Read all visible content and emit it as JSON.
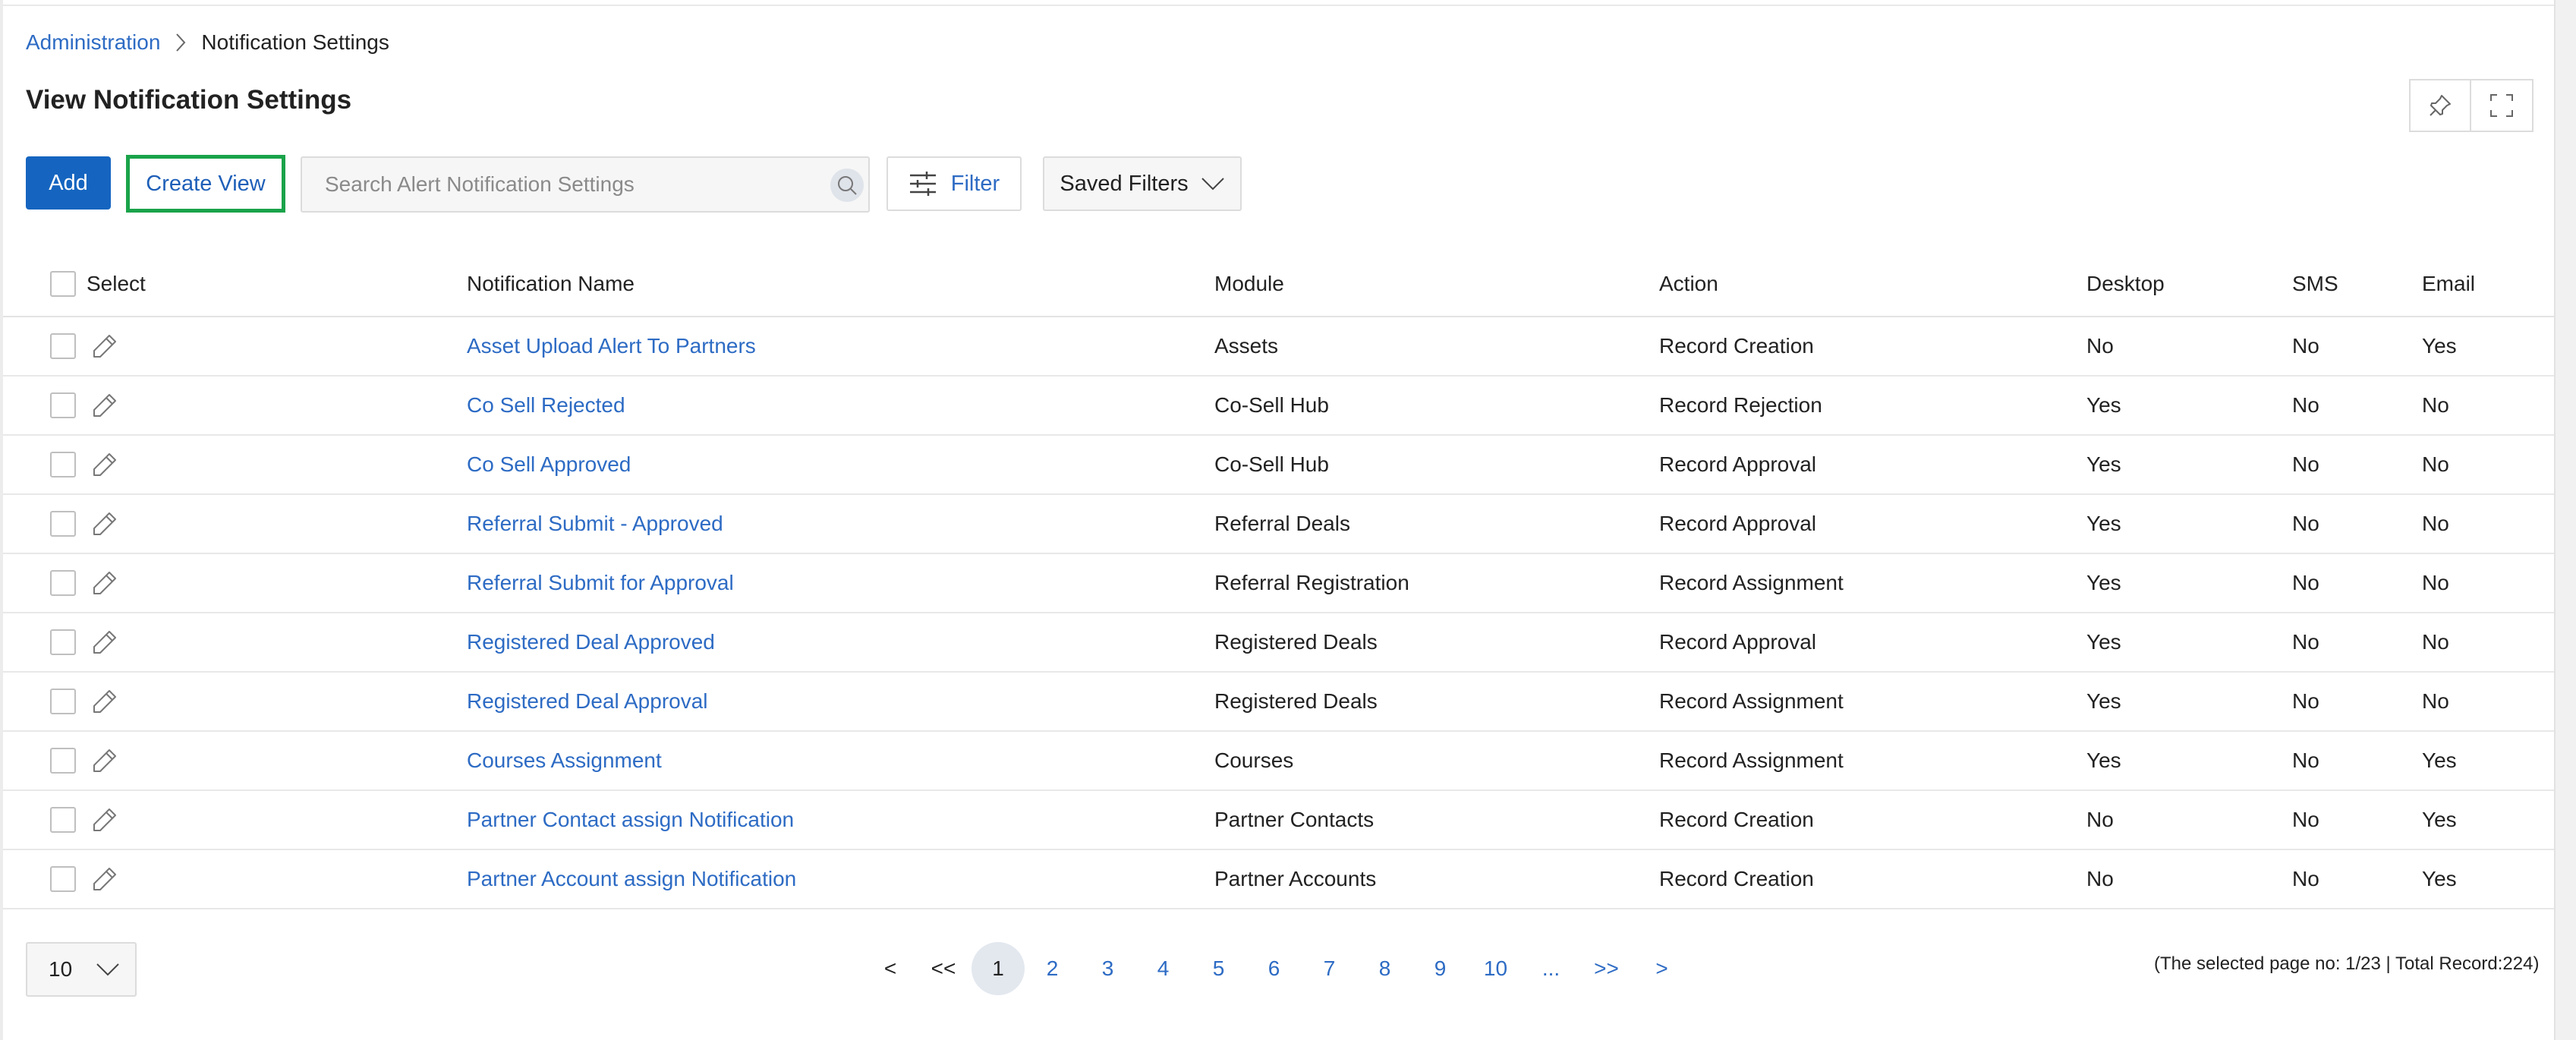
{
  "breadcrumb": {
    "root": "Administration",
    "current": "Notification Settings"
  },
  "page_title": "View Notification Settings",
  "toolbar": {
    "add_label": "Add",
    "create_view_label": "Create View",
    "search_placeholder": "Search Alert Notification Settings",
    "filter_label": "Filter",
    "saved_filters_label": "Saved Filters"
  },
  "table": {
    "columns": {
      "select": "Select",
      "name": "Notification Name",
      "module": "Module",
      "action": "Action",
      "desktop": "Desktop",
      "sms": "SMS",
      "email": "Email"
    },
    "rows": [
      {
        "name": "Asset Upload Alert To Partners",
        "module": "Assets",
        "action": "Record Creation",
        "desktop": "No",
        "sms": "No",
        "email": "Yes"
      },
      {
        "name": "Co Sell Rejected",
        "module": "Co-Sell Hub",
        "action": "Record Rejection",
        "desktop": "Yes",
        "sms": "No",
        "email": "No"
      },
      {
        "name": "Co Sell Approved",
        "module": "Co-Sell Hub",
        "action": "Record Approval",
        "desktop": "Yes",
        "sms": "No",
        "email": "No"
      },
      {
        "name": "Referral Submit - Approved",
        "module": "Referral Deals",
        "action": "Record Approval",
        "desktop": "Yes",
        "sms": "No",
        "email": "No"
      },
      {
        "name": "Referral Submit for Approval",
        "module": "Referral Registration",
        "action": "Record Assignment",
        "desktop": "Yes",
        "sms": "No",
        "email": "No"
      },
      {
        "name": "Registered Deal Approved",
        "module": "Registered Deals",
        "action": "Record Approval",
        "desktop": "Yes",
        "sms": "No",
        "email": "No"
      },
      {
        "name": "Registered Deal Approval",
        "module": "Registered Deals",
        "action": "Record Assignment",
        "desktop": "Yes",
        "sms": "No",
        "email": "No"
      },
      {
        "name": "Courses Assignment",
        "module": "Courses",
        "action": "Record Assignment",
        "desktop": "Yes",
        "sms": "No",
        "email": "Yes"
      },
      {
        "name": "Partner Contact assign Notification",
        "module": "Partner Contacts",
        "action": "Record Creation",
        "desktop": "No",
        "sms": "No",
        "email": "Yes"
      },
      {
        "name": "Partner Account assign Notification",
        "module": "Partner Accounts",
        "action": "Record Creation",
        "desktop": "No",
        "sms": "No",
        "email": "Yes"
      }
    ]
  },
  "pagination": {
    "page_size": "10",
    "prev": "<",
    "first": "<<",
    "pages": [
      "1",
      "2",
      "3",
      "4",
      "5",
      "6",
      "7",
      "8",
      "9",
      "10"
    ],
    "ellipsis": "...",
    "last": ">>",
    "next": ">",
    "current_page": "1",
    "info": "(The selected page no: 1/23 | Total Record:224)"
  },
  "colors": {
    "primary": "#1565c0",
    "link": "#2d6bc4",
    "highlight_border": "#1aa34a"
  },
  "icons": {
    "pin": "pin-icon",
    "fullscreen": "fullscreen-icon",
    "search": "search-icon",
    "filter": "sliders-icon",
    "chevron": "chevron-down-icon",
    "edit": "pencil-icon",
    "breadcrumb_sep": "chevron-right-icon"
  }
}
